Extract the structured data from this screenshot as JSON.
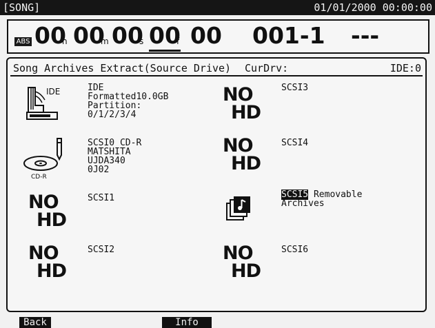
{
  "topbar": {
    "song": "[SONG]",
    "datetime": "01/01/2000 00:00:00"
  },
  "counter": {
    "abs": "ABS",
    "hours": "00",
    "hours_unit": "h",
    "minutes": "00",
    "minutes_unit": "m",
    "seconds": "00",
    "seconds_unit": "s",
    "frames": "00",
    "frames_unit": "f",
    "subframes": "00",
    "measure": "001-1",
    "extra": "---"
  },
  "header": {
    "title": "Song Archives Extract(Source Drive)",
    "cur_label": "CurDrv:",
    "cur_value": "IDE:0"
  },
  "drives": {
    "ide": {
      "icon_label": "IDE",
      "lines": [
        "IDE",
        "Formatted10.0GB",
        "Partition:",
        "0/1/2/3/4"
      ]
    },
    "scsi0": {
      "icon_label": "CD-R",
      "lines": [
        "SCSI0 CD-R",
        "MATSHITA",
        "UJDA340",
        "0J02"
      ]
    },
    "scsi1": {
      "label": "SCSI1",
      "nohd": [
        "NO",
        "HD"
      ]
    },
    "scsi2": {
      "label": "SCSI2",
      "nohd": [
        "NO",
        "HD"
      ]
    },
    "scsi3": {
      "label": "SCSI3",
      "nohd": [
        "NO",
        "HD"
      ]
    },
    "scsi4": {
      "label": "SCSI4",
      "nohd": [
        "NO",
        "HD"
      ]
    },
    "scsi5": {
      "label": "SCSI5",
      "line1": "Removable",
      "line2": "Archives"
    },
    "scsi6": {
      "label": "SCSI6",
      "nohd": [
        "NO",
        "HD"
      ]
    }
  },
  "footer": {
    "back": "Back",
    "info": "Info"
  }
}
